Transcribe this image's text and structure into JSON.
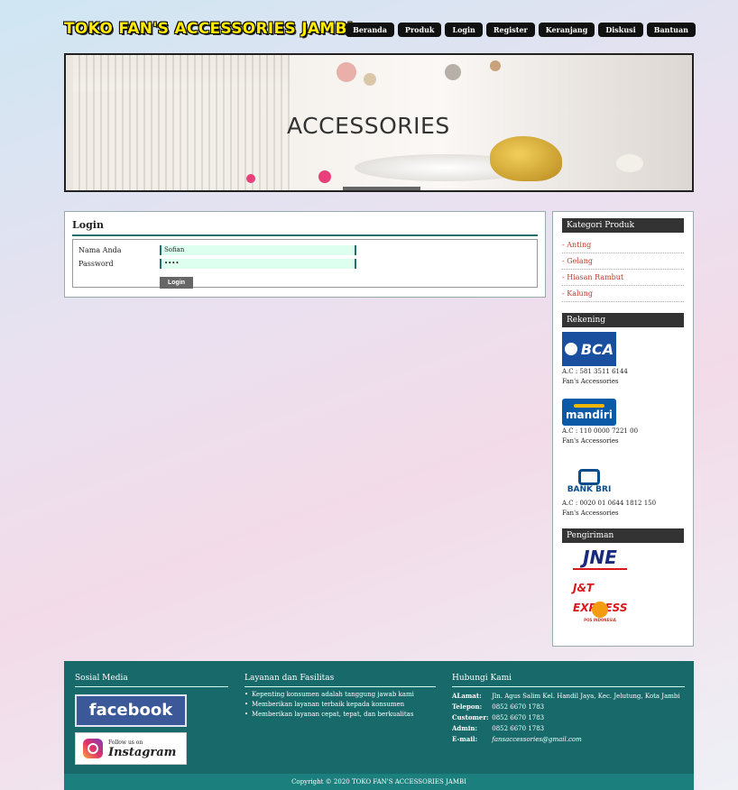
{
  "header": {
    "logo": "TOKO FAN'S ACCESSORIES JAMBI",
    "nav": [
      "Beranda",
      "Produk",
      "Login",
      "Register",
      "Keranjang",
      "Diskusi",
      "Bantuan"
    ]
  },
  "banner": {
    "title": "ACCESSORIES"
  },
  "login": {
    "title": "Login",
    "name_label": "Nama Anda",
    "name_value": "Sofian",
    "password_label": "Password",
    "password_value": "••••",
    "button": "Login"
  },
  "sidebar": {
    "category_title": "Kategori Produk",
    "categories": [
      "- Anting",
      "- Gelang",
      "- Hiasan Rambut",
      "- Kalung"
    ],
    "rekening_title": "Rekening",
    "banks": [
      {
        "name": "BCA",
        "account": "A.C : 581 3511 6144",
        "holder": "Fan's Accessories"
      },
      {
        "name": "mandiri",
        "account": "A.C : 110 0000 7221 00",
        "holder": "Fan's Accessories"
      },
      {
        "name": "BANK BRI",
        "account": "A.C : 0020 01 0644 1812 150",
        "holder": "Fan's Accessories"
      }
    ],
    "shipping_title": "Pengiriman",
    "couriers": [
      "JNE",
      "J&T EXPRESS",
      "POS INDONESIA"
    ]
  },
  "footer": {
    "social_title": "Sosial Media",
    "facebook": "facebook",
    "instagram_follow": "Follow us on",
    "instagram": "Instagram",
    "services_title": "Layanan dan Fasilitas",
    "services": [
      "Kepenting konsumen adalah tanggung jawab kami",
      "Memberikan layanan terbaik kepada konsumen",
      "Memberikan layanan cepat, tepat, dan berkualitas"
    ],
    "contact_title": "Hubungi Kami",
    "address_label": "ALamat:",
    "address": "Jln. Agus Salim Kel. Handil Jaya, Kec. Jelutung, Kota Jambi",
    "phone_label": "Telepon:",
    "phone": "0852 6670 1783",
    "customer_label": "Customer:",
    "customer": "0852 6670 1783",
    "admin_label": "Admin:",
    "admin": "0852 6670 1783",
    "email_label": "E-mail:",
    "email": "fansaccessories@gmail.com",
    "copyright": "Copyright © 2020 TOKO FAN'S ACCESSORIES JAMBI"
  },
  "colors": {
    "accent": "#17696a",
    "logo": "#ffea00",
    "category": "#c0392b"
  }
}
